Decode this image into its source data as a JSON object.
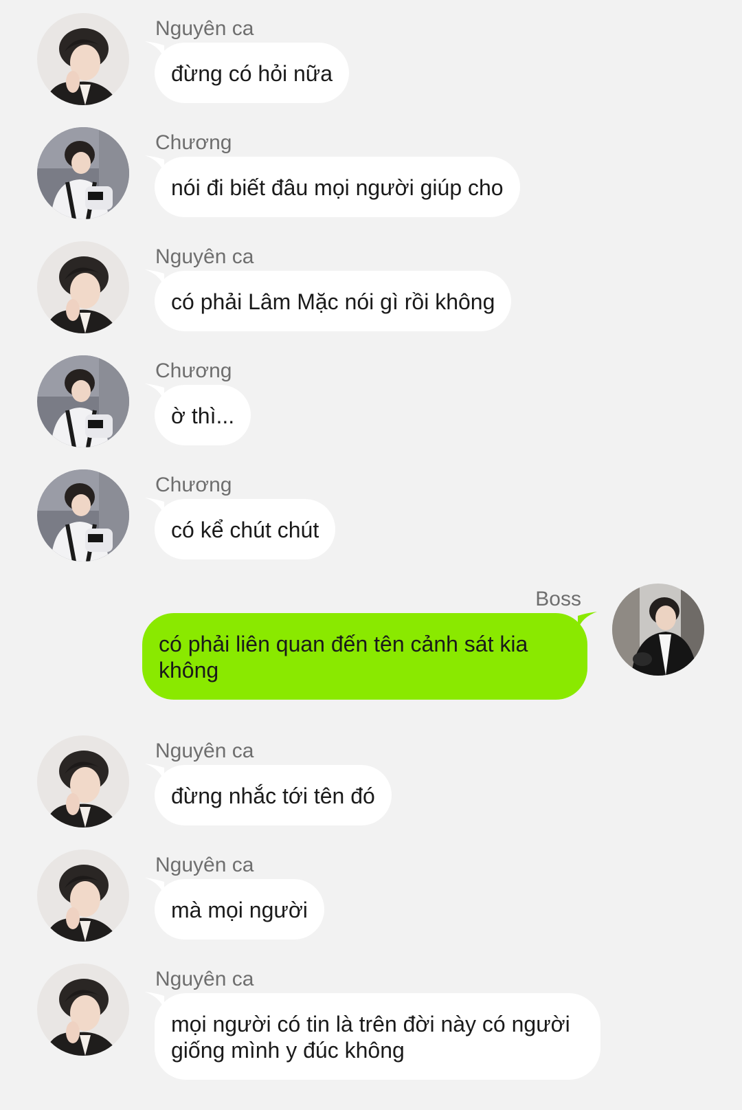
{
  "colors": {
    "background": "#f2f2f2",
    "incoming_bubble": "#ffffff",
    "outgoing_bubble": "#8ae900",
    "sender_name": "#6e6e6e",
    "message_text": "#1a1a1a"
  },
  "messages": [
    {
      "sender": "Nguyên ca",
      "text": "đừng có hỏi nữa",
      "avatar": "nguyen-ca-avatar"
    },
    {
      "sender": "Chương",
      "text": "nói đi biết đâu mọi người giúp cho",
      "avatar": "chuong-avatar"
    },
    {
      "sender": "Nguyên ca",
      "text": "có phải Lâm Mặc nói gì rồi không",
      "avatar": "nguyen-ca-avatar"
    },
    {
      "sender": "Chương",
      "text": "ờ thì...",
      "avatar": "chuong-avatar"
    },
    {
      "sender": "Chương",
      "text": "có kể chút chút",
      "avatar": "chuong-avatar"
    },
    {
      "sender": "Boss",
      "text": "có phải liên quan đến tên cảnh sát kia không",
      "avatar": "boss-avatar"
    },
    {
      "sender": "Nguyên ca",
      "text": "đừng nhắc tới tên đó",
      "avatar": "nguyen-ca-avatar"
    },
    {
      "sender": "Nguyên ca",
      "text": "mà mọi người",
      "avatar": "nguyen-ca-avatar"
    },
    {
      "sender": "Nguyên ca",
      "text": "mọi người có tin là trên đời này có người giống mình y đúc không",
      "avatar": "nguyen-ca-avatar"
    }
  ]
}
